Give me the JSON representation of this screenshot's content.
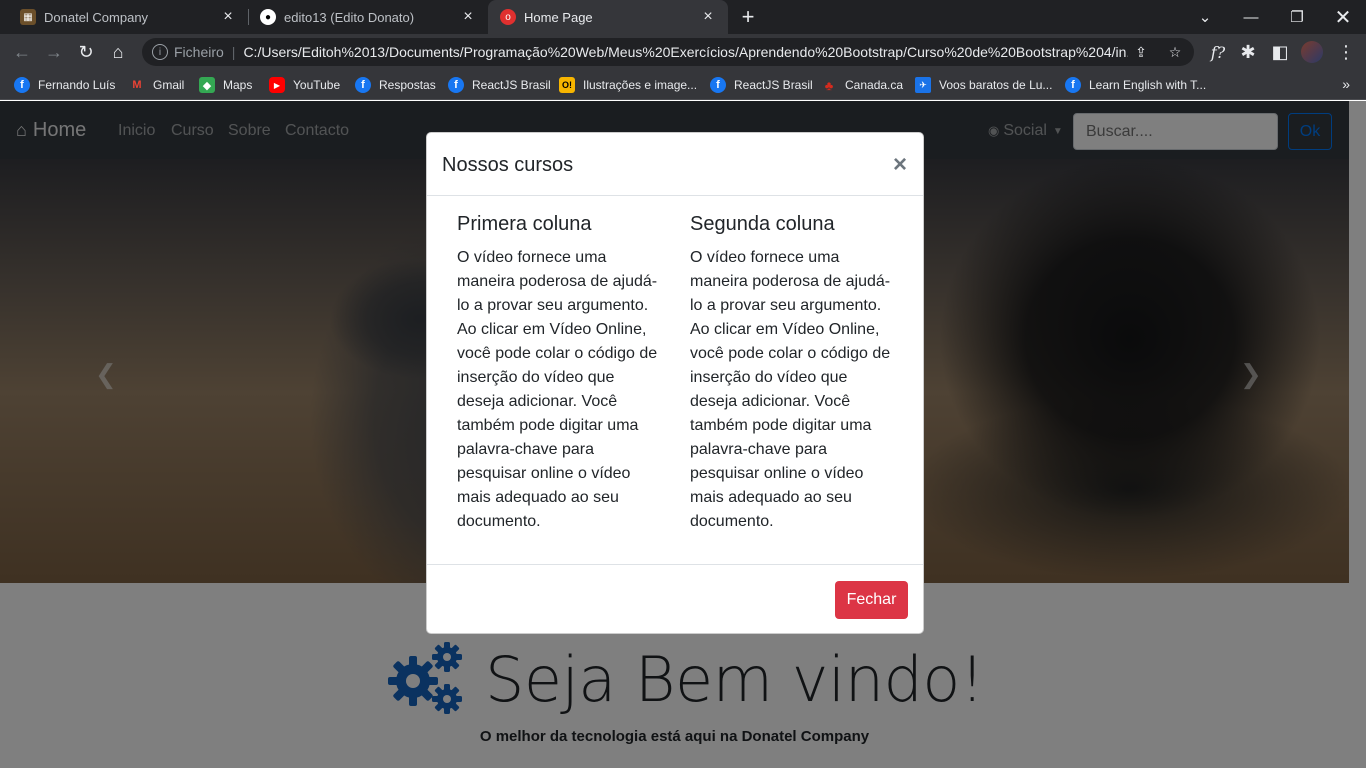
{
  "browser": {
    "tabs": [
      {
        "title": "Donatel Company",
        "icon": "web-favicon-icon"
      },
      {
        "title": "edito13 (Edito Donato)",
        "icon": "github-icon"
      },
      {
        "title": "Home Page",
        "icon": "opera-icon"
      }
    ],
    "address": {
      "scheme": "Ficheiro",
      "url": "C:/Users/Editoh%2013/Documents/Programação%20Web/Meus%20Exercícios/Aprendendo%20Bootstrap/Curso%20de%20Bootstrap%204/in..."
    },
    "bookmarks": [
      {
        "label": "Fernando Luís",
        "icon": "facebook-icon"
      },
      {
        "label": "Gmail",
        "icon": "gmail-icon"
      },
      {
        "label": "Maps",
        "icon": "maps-icon"
      },
      {
        "label": "YouTube",
        "icon": "youtube-icon"
      },
      {
        "label": "Respostas",
        "icon": "facebook-icon"
      },
      {
        "label": "ReactJS Brasil",
        "icon": "facebook-icon"
      },
      {
        "label": "Ilustrações e image...",
        "icon": "illustration-icon"
      },
      {
        "label": "ReactJS Brasil",
        "icon": "facebook-icon"
      },
      {
        "label": "Canada.ca",
        "icon": "maple-leaf-icon"
      },
      {
        "label": "Voos baratos de Lu...",
        "icon": "flights-icon"
      },
      {
        "label": "Learn English with T...",
        "icon": "facebook-icon"
      }
    ]
  },
  "site": {
    "brand": "Home",
    "nav": [
      "Inicio",
      "Curso",
      "Sobre",
      "Contacto"
    ],
    "social": "Social",
    "search_placeholder": "Buscar....",
    "search_button": "Ok",
    "welcome_title": "Seja Bem vindo!",
    "tagline": "O melhor da tecnologia está aqui na Donatel Company"
  },
  "modal": {
    "title": "Nossos cursos",
    "close": "×",
    "columns": [
      {
        "heading": "Primera coluna",
        "text": "O vídeo fornece uma maneira poderosa de ajudá-lo a provar seu argumento. Ao clicar em Vídeo Online, você pode colar o código de inserção do vídeo que deseja adicionar. Você também pode digitar uma palavra-chave para pesquisar online o vídeo mais adequado ao seu documento."
      },
      {
        "heading": "Segunda coluna",
        "text": "O vídeo fornece uma maneira poderosa de ajudá-lo a provar seu argumento. Ao clicar em Vídeo Online, você pode colar o código de inserção do vídeo que deseja adicionar. Você também pode digitar uma palavra-chave para pesquisar online o vídeo mais adequado ao seu documento."
      }
    ],
    "footer_button": "Fechar"
  },
  "colors": {
    "navbar": "#343a40",
    "danger": "#dc3545",
    "primary": "#007bff",
    "cog": "#1565c0"
  }
}
